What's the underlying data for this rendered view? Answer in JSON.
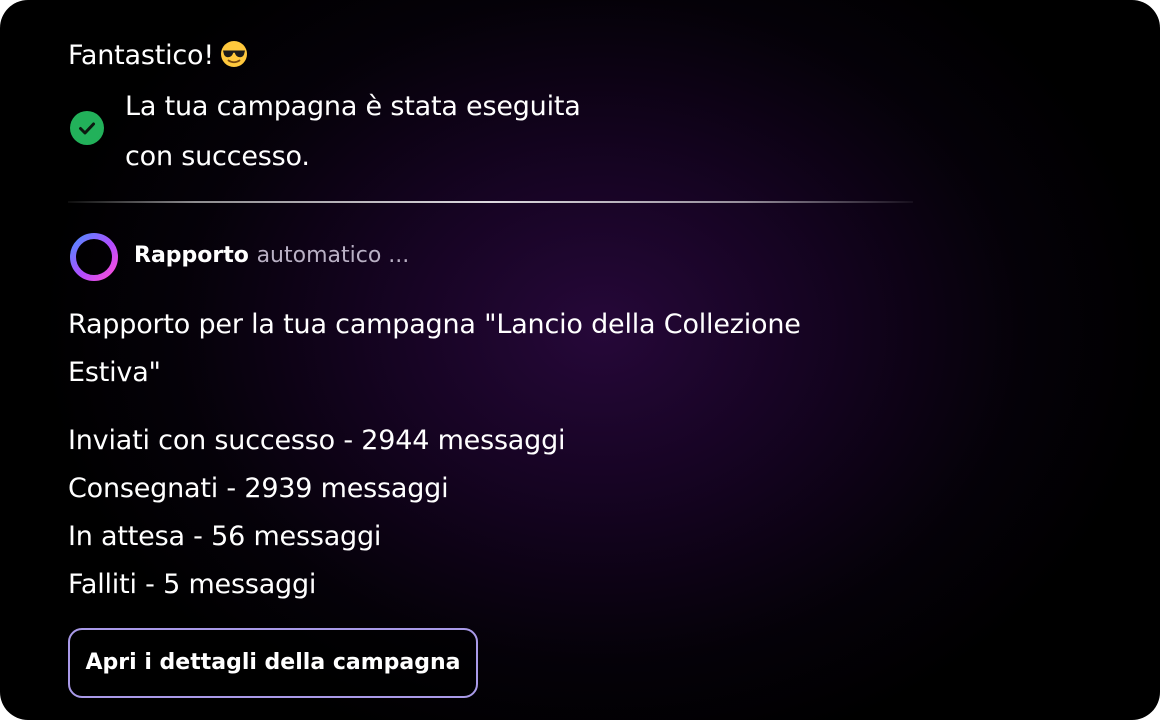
{
  "greeting": {
    "text": "Fantastico!",
    "emoji_icon": "smiling-face-with-sunglasses-icon"
  },
  "success": {
    "icon": "check-circle-icon",
    "icon_color": "#22b15a",
    "message": "La tua campagna è stata eseguita con successo."
  },
  "report": {
    "icon": "gradient-ring-icon",
    "title_strong": "Rapporto",
    "title_muted": "automatico ...",
    "heading": "Rapporto per la tua campagna \"Lancio della Collezione Estiva\"",
    "stats": [
      "Inviati con successo - 2944 messaggi",
      "Consegnati - 2939 messaggi",
      "In attesa - 56 messaggi",
      "Falliti - 5 messaggi"
    ]
  },
  "actions": {
    "details_label": "Apri i dettagli della campagna"
  },
  "colors": {
    "background": "#000000",
    "button_border": "#a99ae8",
    "ring_gradient": [
      "#4f8cff",
      "#b14dff",
      "#ff4fd8"
    ]
  }
}
